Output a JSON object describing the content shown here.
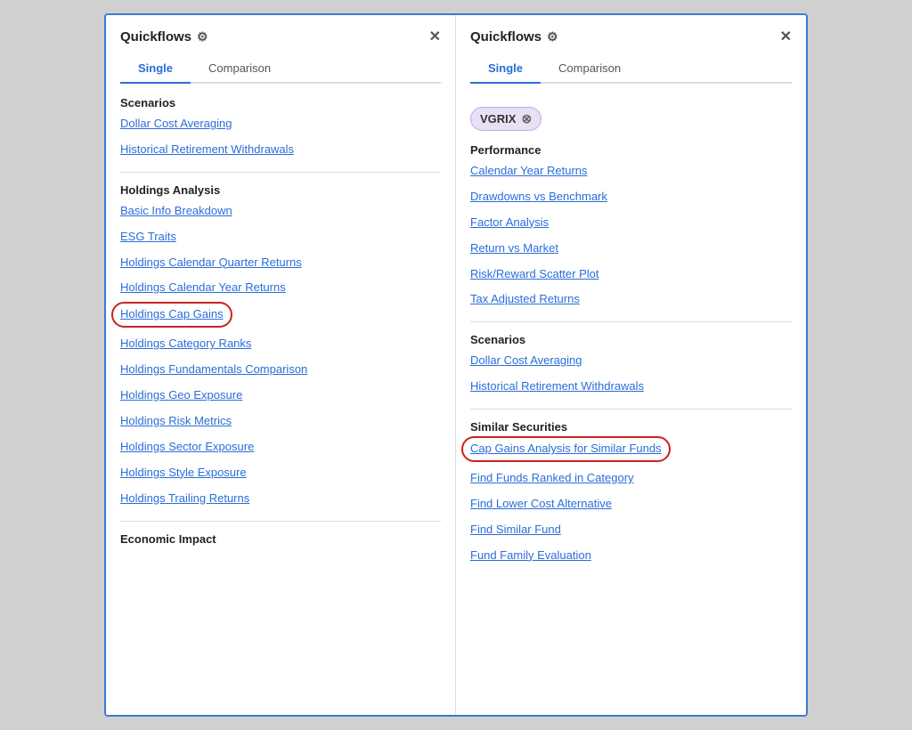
{
  "left_panel": {
    "title": "Quickflows",
    "tabs": [
      {
        "label": "Single",
        "active": true
      },
      {
        "label": "Comparison",
        "active": false
      }
    ],
    "sections": [
      {
        "id": "scenarios",
        "title": "Scenarios",
        "items": [
          {
            "id": "dollar-cost-averaging",
            "label": "Dollar Cost Averaging",
            "circled": false
          },
          {
            "id": "historical-retirement-withdrawals",
            "label": "Historical Retirement Withdrawals",
            "circled": false
          }
        ]
      },
      {
        "id": "holdings-analysis",
        "title": "Holdings Analysis",
        "items": [
          {
            "id": "basic-info-breakdown",
            "label": "Basic Info Breakdown",
            "circled": false
          },
          {
            "id": "esg-traits",
            "label": "ESG Traits",
            "circled": false
          },
          {
            "id": "holdings-calendar-quarter-returns",
            "label": "Holdings Calendar Quarter Returns",
            "circled": false
          },
          {
            "id": "holdings-calendar-year-returns",
            "label": "Holdings Calendar Year Returns",
            "circled": false
          },
          {
            "id": "holdings-cap-gains",
            "label": "Holdings Cap Gains",
            "circled": true
          },
          {
            "id": "holdings-category-ranks",
            "label": "Holdings Category Ranks",
            "circled": false
          },
          {
            "id": "holdings-fundamentals-comparison",
            "label": "Holdings Fundamentals Comparison",
            "circled": false
          },
          {
            "id": "holdings-geo-exposure",
            "label": "Holdings Geo Exposure",
            "circled": false
          },
          {
            "id": "holdings-risk-metrics",
            "label": "Holdings Risk Metrics",
            "circled": false
          },
          {
            "id": "holdings-sector-exposure",
            "label": "Holdings Sector Exposure",
            "circled": false
          },
          {
            "id": "holdings-style-exposure",
            "label": "Holdings Style Exposure",
            "circled": false
          },
          {
            "id": "holdings-trailing-returns",
            "label": "Holdings Trailing Returns",
            "circled": false
          }
        ]
      },
      {
        "id": "economic-impact",
        "title": "Economic Impact",
        "items": []
      }
    ]
  },
  "right_panel": {
    "title": "Quickflows",
    "tabs": [
      {
        "label": "Single",
        "active": true
      },
      {
        "label": "Comparison",
        "active": false
      }
    ],
    "tag": {
      "label": "VGRIX",
      "show": true
    },
    "sections": [
      {
        "id": "performance",
        "title": "Performance",
        "items": [
          {
            "id": "calendar-year-returns",
            "label": "Calendar Year Returns",
            "circled": false
          },
          {
            "id": "drawdowns-vs-benchmark",
            "label": "Drawdowns vs Benchmark",
            "circled": false
          },
          {
            "id": "factor-analysis",
            "label": "Factor Analysis",
            "circled": false
          },
          {
            "id": "return-vs-market",
            "label": "Return vs Market",
            "circled": false
          },
          {
            "id": "risk-reward-scatter-plot",
            "label": "Risk/Reward Scatter Plot",
            "circled": false
          },
          {
            "id": "tax-adjusted-returns",
            "label": "Tax Adjusted Returns",
            "circled": false
          }
        ]
      },
      {
        "id": "scenarios",
        "title": "Scenarios",
        "items": [
          {
            "id": "dollar-cost-averaging-r",
            "label": "Dollar Cost Averaging",
            "circled": false
          },
          {
            "id": "historical-retirement-withdrawals-r",
            "label": "Historical Retirement Withdrawals",
            "circled": false
          }
        ]
      },
      {
        "id": "similar-securities",
        "title": "Similar Securities",
        "items": [
          {
            "id": "cap-gains-analysis-similar-funds",
            "label": "Cap Gains Analysis for Similar Funds",
            "circled": true
          },
          {
            "id": "find-funds-ranked-in-category",
            "label": "Find Funds Ranked in Category",
            "circled": false
          },
          {
            "id": "find-lower-cost-alternative",
            "label": "Find Lower Cost Alternative",
            "circled": false
          },
          {
            "id": "find-similar-fund",
            "label": "Find Similar Fund",
            "circled": false
          },
          {
            "id": "fund-family-evaluation",
            "label": "Fund Family Evaluation",
            "circled": false
          }
        ]
      }
    ]
  }
}
